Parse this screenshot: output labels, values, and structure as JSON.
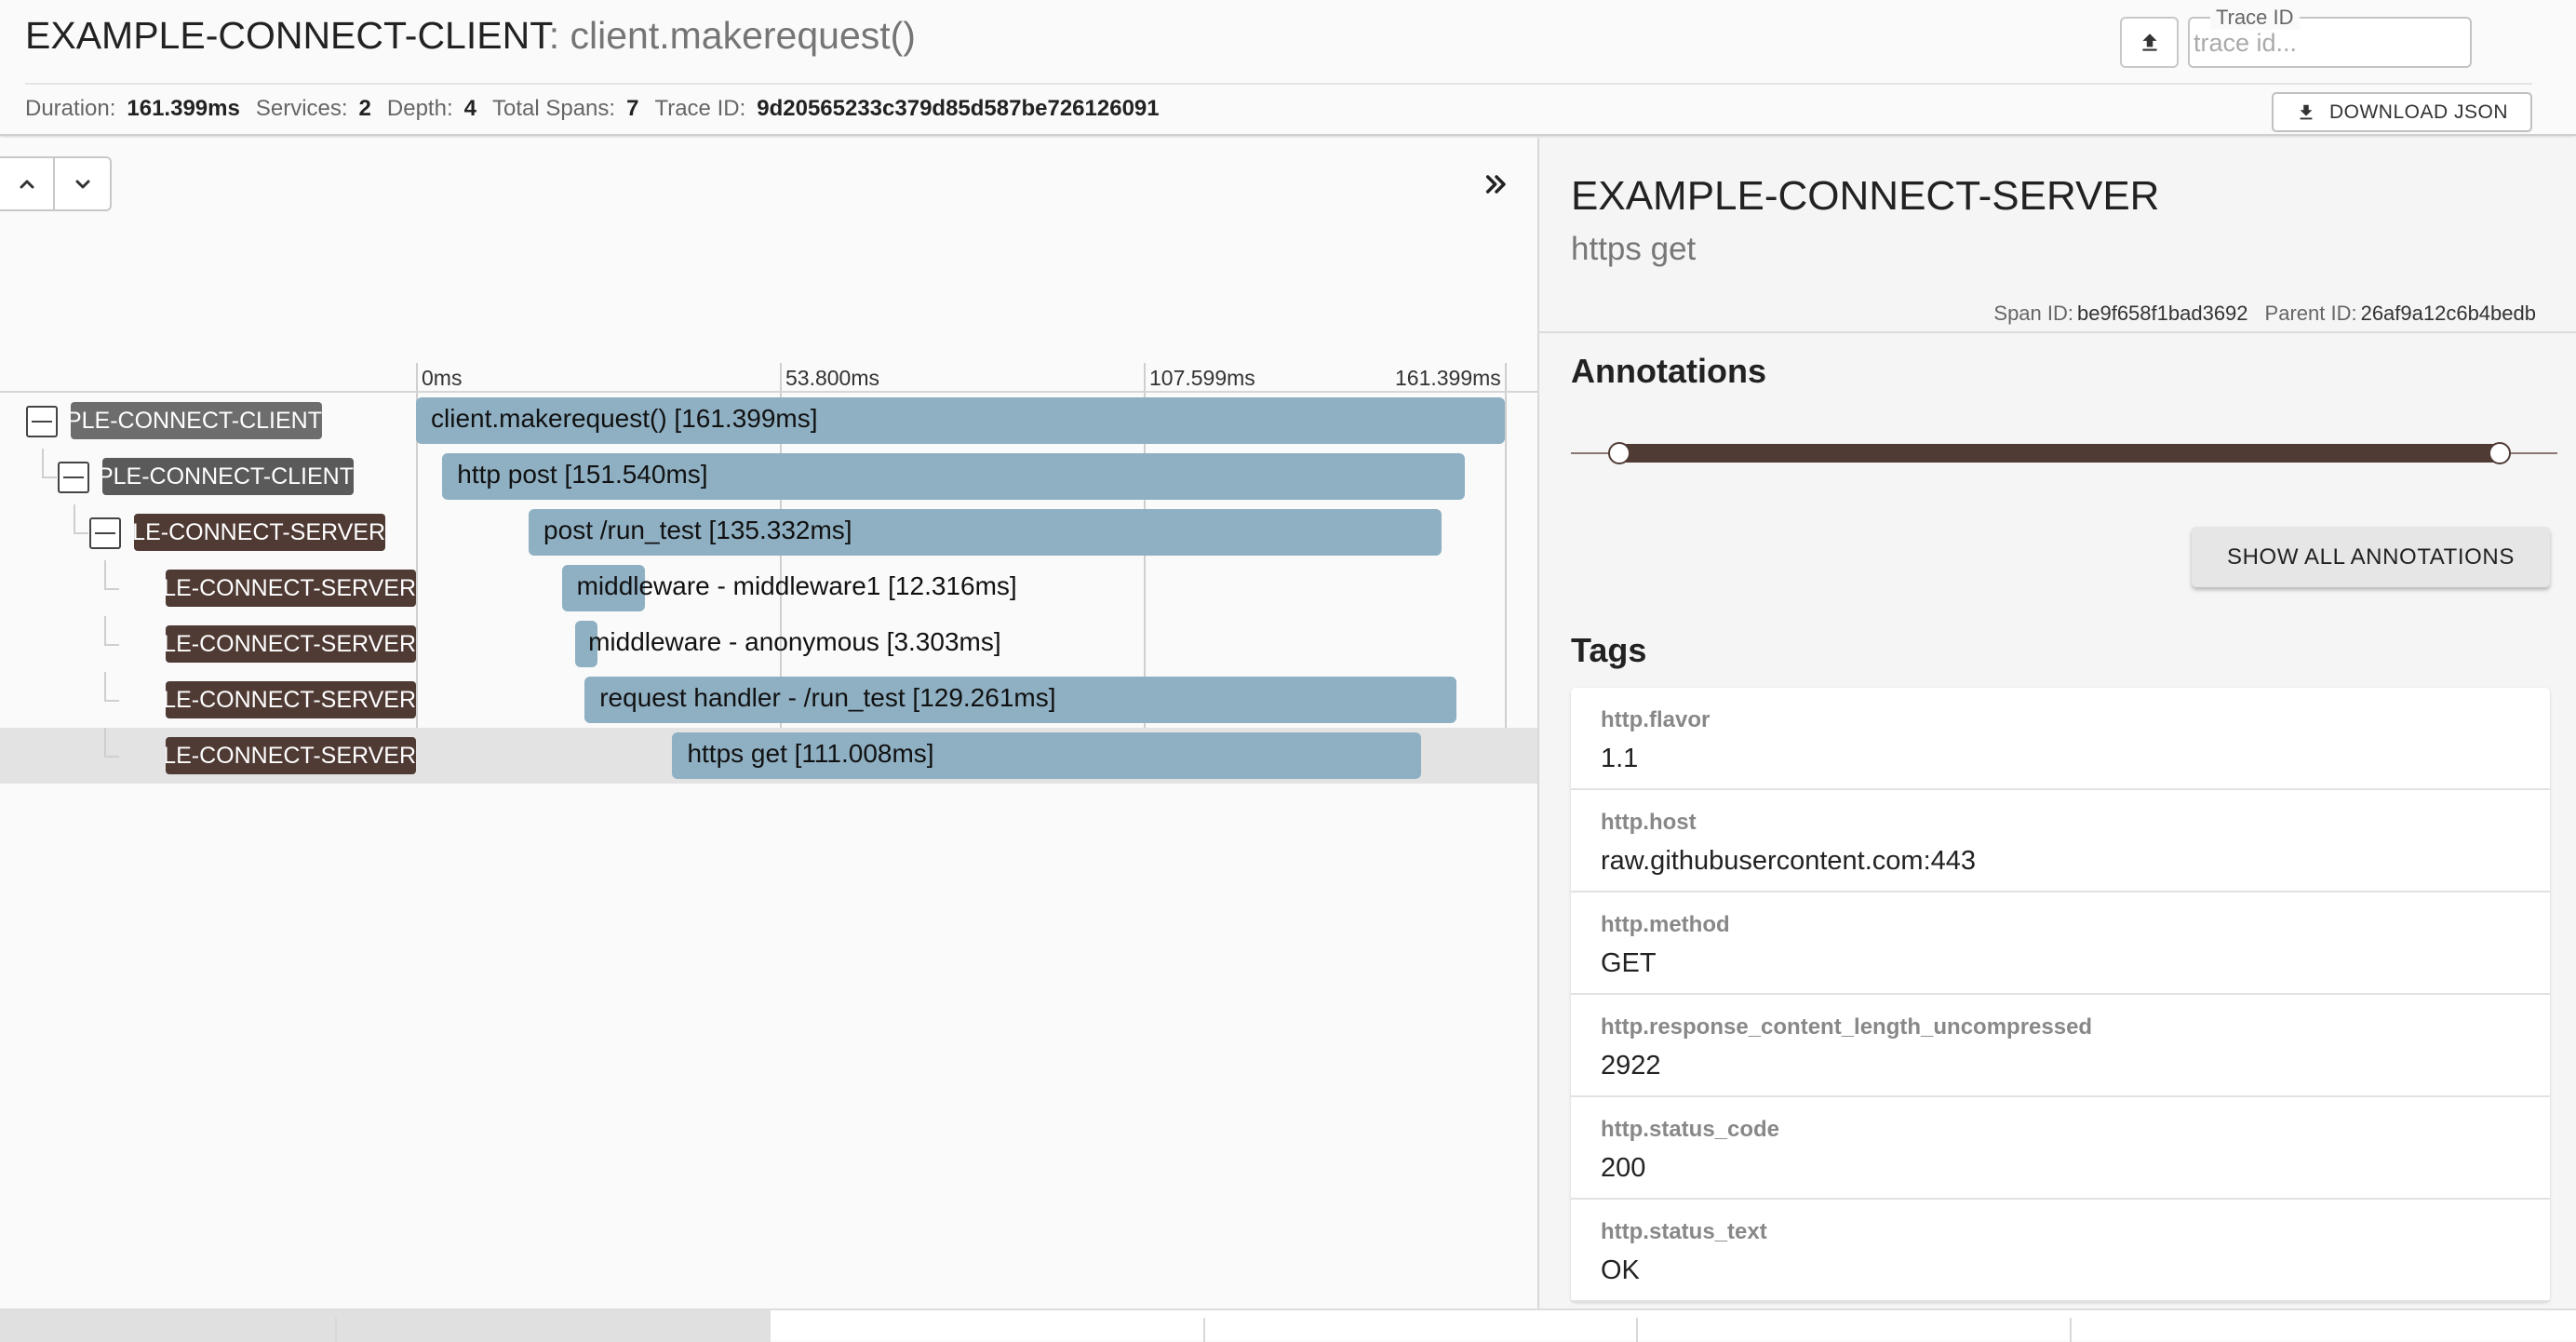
{
  "header": {
    "service_name": "EXAMPLE-CONNECT-CLIENT",
    "separator": ":",
    "span_name": "client.makerequest()",
    "trace_id_label": "Trace ID",
    "trace_id_placeholder": "trace id...",
    "download_label": "DOWNLOAD JSON",
    "icons": {
      "upload": "upload-icon",
      "download": "download-icon"
    }
  },
  "stats": {
    "duration_label": "Duration:",
    "duration": "161.399ms",
    "services_label": "Services:",
    "services": "2",
    "depth_label": "Depth:",
    "depth": "4",
    "spans_label": "Total Spans:",
    "spans": "7",
    "traceid_label": "Trace ID:",
    "traceid": "9d20565233c379d85d587be726126091"
  },
  "timeline": {
    "ticks": [
      "0ms",
      "53.800ms",
      "107.599ms",
      "161.399ms"
    ],
    "total_ms": 161.399,
    "spans": [
      {
        "service": "EXAMPLE-CONNECT-CLIENT",
        "label": "client.makerequest() [161.399ms]",
        "start_ms": 0.0,
        "duration_ms": 161.399,
        "depth": 0,
        "kind": "client",
        "collapsible": true
      },
      {
        "service": "EXAMPLE-CONNECT-CLIENT",
        "label": "http post [151.540ms]",
        "start_ms": 3.9,
        "duration_ms": 151.54,
        "depth": 1,
        "kind": "client",
        "collapsible": true
      },
      {
        "service": "EXAMPLE-CONNECT-SERVER",
        "label": "post /run_test [135.332ms]",
        "start_ms": 16.7,
        "duration_ms": 135.332,
        "depth": 2,
        "kind": "server",
        "collapsible": true
      },
      {
        "service": "EXAMPLE-CONNECT-SERVER",
        "label": "middleware - middleware1 [12.316ms]",
        "start_ms": 21.6,
        "duration_ms": 12.316,
        "depth": 3,
        "kind": "server",
        "collapsible": false
      },
      {
        "service": "EXAMPLE-CONNECT-SERVER",
        "label": "middleware - anonymous [3.303ms]",
        "start_ms": 23.6,
        "duration_ms": 3.303,
        "depth": 3,
        "kind": "server",
        "collapsible": false
      },
      {
        "service": "EXAMPLE-CONNECT-SERVER",
        "label": "request handler - /run_test [129.261ms]",
        "start_ms": 25.0,
        "duration_ms": 129.261,
        "depth": 3,
        "kind": "server",
        "collapsible": false
      },
      {
        "service": "EXAMPLE-CONNECT-SERVER",
        "label": "https get [111.008ms]",
        "start_ms": 38.0,
        "duration_ms": 111.008,
        "depth": 3,
        "kind": "server",
        "collapsible": false,
        "selected": true
      }
    ]
  },
  "detail": {
    "service_name": "EXAMPLE-CONNECT-SERVER",
    "span_name": "https get",
    "span_id_label": "Span ID:",
    "span_id": "be9f658f1bad3692",
    "parent_id_label": "Parent ID:",
    "parent_id": "26af9a12c6b4bedb",
    "annotations_title": "Annotations",
    "show_all_label": "SHOW ALL ANNOTATIONS",
    "tags_title": "Tags",
    "tags": [
      {
        "key": "http.flavor",
        "value": "1.1"
      },
      {
        "key": "http.host",
        "value": "raw.githubusercontent.com:443"
      },
      {
        "key": "http.method",
        "value": "GET"
      },
      {
        "key": "http.response_content_length_uncompressed",
        "value": "2922"
      },
      {
        "key": "http.status_code",
        "value": "200"
      },
      {
        "key": "http.status_text",
        "value": "OK"
      }
    ]
  },
  "colors": {
    "server_badge": "#4f3a34",
    "client_badge": "#6d6d6d",
    "span_bar": "#8fb0c3",
    "selected_row": "#e3e3e3"
  }
}
